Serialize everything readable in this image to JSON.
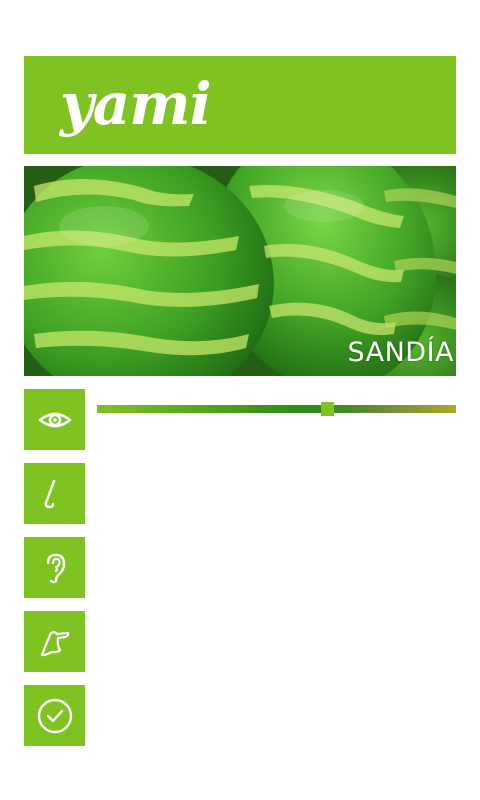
{
  "app": {
    "logo_text": "yami"
  },
  "hero": {
    "label": "SANDÍA",
    "image": "watermelon-photo"
  },
  "senses": [
    {
      "id": "sight",
      "icon": "eye-icon"
    },
    {
      "id": "smell",
      "icon": "nose-icon"
    },
    {
      "id": "hearing",
      "icon": "ear-icon"
    },
    {
      "id": "touch",
      "icon": "hand-icon"
    },
    {
      "id": "done",
      "icon": "check-circle-icon"
    }
  ],
  "slider": {
    "value_fraction": 0.64
  },
  "colors": {
    "accent": "#7fc322",
    "track_dark": "#2f8c16",
    "track_end": "#b0a826",
    "background": "#ffffff"
  }
}
